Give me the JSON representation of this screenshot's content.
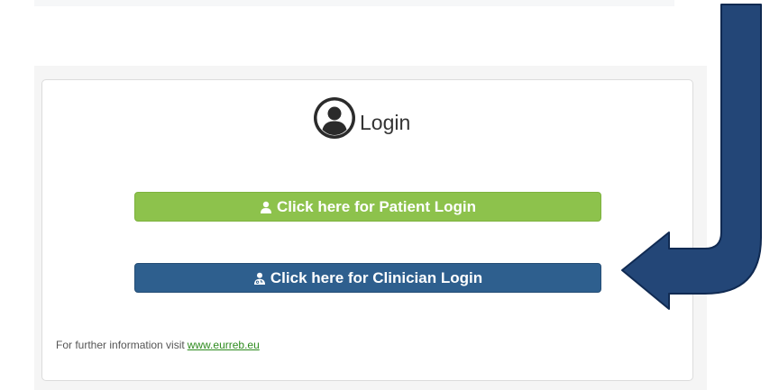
{
  "login": {
    "title": "Login",
    "patient_button_label": "Click here for Patient Login",
    "clinician_button_label": "Click here for Clinician Login",
    "info_prefix": "For further information visit",
    "info_link_text": "www.eurreb.eu"
  },
  "colors": {
    "patient_button": "#8dc24c",
    "clinician_button": "#2e5f8e",
    "arrow_fill": "#234677",
    "link": "#2e8b1e"
  },
  "icons": {
    "header": "user-circle-icon",
    "patient": "user-icon",
    "clinician": "user-md-icon",
    "annotation": "bent-arrow-icon"
  }
}
